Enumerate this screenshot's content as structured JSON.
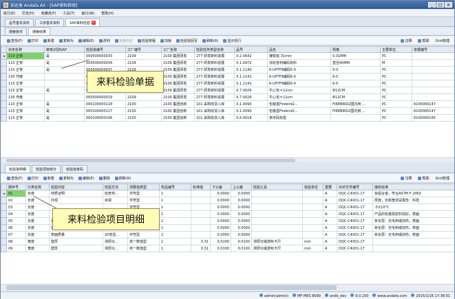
{
  "window": {
    "title": "安达发 Andafa AX - [SAP来料检验]",
    "buttons": [
      "_",
      "□",
      "×"
    ]
  },
  "menu": [
    "执行(E)",
    "历史(H)",
    "收藏夹(F)",
    "工具(T)",
    "窗口(W)",
    "帮助(H)"
  ],
  "doc_tabs": [
    "品号基本资料",
    "工序基本资料",
    "SAP来料检验"
  ],
  "sub_tabs": [
    "搜索条件",
    "搜索结果"
  ],
  "toolbar1": {
    "items": [
      "查找(F)",
      "打印",
      "新建",
      "复制为",
      "编辑(E)",
      "改判",
      "批量检验",
      "检验排程",
      "加锁",
      "检验批回写",
      "刷新(R)",
      "显示执行"
    ],
    "right": [
      "注释",
      "帮助",
      "Grid管理"
    ]
  },
  "upper_grid": {
    "columns": [
      "状态名称",
      "审核识别SAP",
      "检验批编号",
      "工厂编号",
      "工厂名称",
      "检验任务类型名称",
      "品号",
      "品名",
      "规格",
      "主要单位",
      "单据编号"
    ],
    "rows": [
      [
        "110 正常",
        "是",
        "000500000033",
        "2109",
        "2109 集团研发",
        "277 研发新料进展",
        "X.2.0642",
        "镀铁铭 31mm",
        "0.31MM",
        "PC",
        ""
      ],
      [
        "110 正常",
        "是",
        "000500000034",
        "2109",
        "2109 集团研发",
        "277 研发新料进展",
        "X.1.0972",
        "冻轮管材编码有料",
        "直径40MM",
        "M",
        ""
      ],
      [
        "110 正常",
        "是",
        "000500000037",
        "2109",
        "2109 集团研发",
        "277 研发新料进展",
        "X.1.1140",
        "6-UPTF8编码5-0",
        "5-0",
        "PC",
        ""
      ],
      [
        "130 作废",
        "",
        "000500000036",
        "2109",
        "2109 集团研发",
        "277 研发新料进展",
        "X.1.1141",
        "6-UPTF8编码6-0",
        "6-0",
        "PC",
        ""
      ],
      [
        "110 正常",
        "",
        "000500000064",
        "2109",
        "2109 集团研发",
        "277 研发新料进展",
        "X.1.1141",
        "6-UPTF8编码6-0",
        "6-0",
        "PC",
        ""
      ],
      [
        "110 正常",
        "是",
        "000500000039",
        "2109",
        "2109 集团研发",
        "277 研发新料进展",
        "X.7.0026",
        "牛心包＊12cm",
        "Φ12CM",
        "PC",
        ""
      ],
      [
        "130 作废",
        "",
        "000500000019",
        "2109",
        "2109 集团研发",
        "277 研发新料进展",
        "X.7.0026",
        "牛心包＊12cm",
        "Φ12CM",
        "PC",
        ""
      ],
      [
        "110 正常",
        "是",
        "000100000118",
        "2100",
        "2100 集团创新",
        "101 采购收货入库",
        "X.1.0090",
        "包装盒Firebird2...",
        "FIREBIRD2国内用 ...",
        "PC",
        "6100000147"
      ],
      [
        "110 正常",
        "是",
        "000100000117",
        "2100",
        "2100 集团创新",
        "101 采购收货入库",
        "X.1.0090",
        "包装盒Firebird2...",
        "FIREBIRD2国内用 ...",
        "PC",
        "6100000147"
      ],
      [
        "110 正常",
        "是",
        "000100000106",
        "2100",
        "2100 集团创新",
        "101 采购收货入库",
        "X.6.0018",
        "条形码标签",
        "",
        "PC",
        "6100000165"
      ]
    ]
  },
  "callout_top": "来料检验单据",
  "lower_tabs": [
    "检验批明细",
    "检验项目统计",
    "检验批条码"
  ],
  "toolbar2": {
    "items": [
      "查找(F)",
      "打印",
      "新建",
      "复制为",
      "编辑(E)",
      "删除",
      "刷新(R)"
    ],
    "right": [
      "注释",
      "帮助",
      "Grid管理"
    ]
  },
  "lower_grid": {
    "columns": [
      "顺序号",
      "分类名称",
      "检验内容",
      "检验方法",
      "测量值类型",
      "样品编号",
      "标准值",
      "下公差",
      "上公差",
      "检验工具",
      "检验单位",
      "重要",
      "SOP文件编号",
      "接收标准"
    ],
    "rows": [
      [
        "01",
        "长度",
        "材质证明",
        "检查材...",
        "字符型",
        "1",
        "",
        "0.0000",
        "0.0000",
        "",
        "",
        "A",
        "DQC-C4X01-17",
        "钛铝合金，符合ASTM F 2063"
      ],
      [
        "02",
        "长度",
        "外观",
        "目视",
        "字符型",
        "1",
        "",
        "0.0000",
        "0.0000",
        "",
        "",
        "A",
        "DQC-C4X01-17",
        "厚度，长和宽测试报告：科技"
      ],
      [
        "03",
        "长度",
        "",
        "",
        "字符型",
        "1",
        "",
        "0.0000",
        "0.0000",
        "",
        "",
        "A",
        "DQC-C4X01-17",
        "-5±10℃"
      ],
      [
        "04",
        "长度",
        "",
        "",
        "字符型",
        "1",
        "",
        "0.0000",
        "0.0000",
        "",
        "",
        "A",
        "DQC-C4X01-17",
        "产品的包装需密封完好，表面"
      ],
      [
        "05",
        "长度",
        "表面质量",
        "20倍显...",
        "字符型",
        "1",
        "",
        "0.0000",
        "0.0000",
        "",
        "",
        "A",
        "DQC-C4X01-17",
        "氧化层：无毛刺或划伤，表面"
      ],
      [
        "06",
        "长度",
        "表面质量",
        "20倍显...",
        "字符型",
        "1",
        "",
        "0.0000",
        "0.0000",
        "",
        "",
        "A",
        "DQC-C4X01-17",
        "氧化层：无毛刺或划伤，表面"
      ],
      [
        "07",
        "长度",
        "表面质量",
        "20倍显...",
        "字符型",
        "2",
        "",
        "0.0000",
        "0.0000",
        "",
        "",
        "A",
        "DQC-C4X01-17",
        "氧化层：无毛刺或划伤，表面"
      ],
      [
        "08",
        "宽度",
        "壁厚",
        "测厚仪...",
        "单一数值型",
        "1",
        "0.31",
        "0.0100",
        "0.0100",
        "测厚仪或游标卡尺",
        "mm",
        "A",
        "DQC-C4X01-17",
        ""
      ],
      [
        "09",
        "宽度",
        "壁厚",
        "测厚仪...",
        "单一数值型",
        "1",
        "0.31",
        "0.0100",
        "0.0100",
        "测厚仪或游标卡尺",
        "mm",
        "A",
        "DQC-C4X01-17",
        ""
      ]
    ]
  },
  "callout_bottom": "来料检验项目明细",
  "status": [
    "admin(admin)",
    "MF-MES 8090",
    "andb_dev",
    "9.0.150",
    "www.andafa.com",
    "2015/1/16 17:36:01"
  ]
}
